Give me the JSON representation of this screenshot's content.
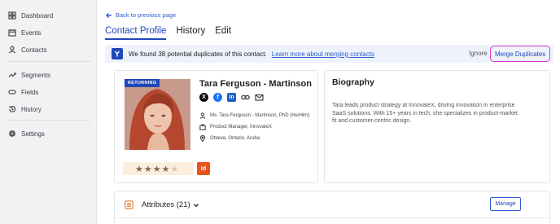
{
  "sidebar": {
    "items": [
      {
        "label": "Dashboard",
        "icon": "dashboard-icon"
      },
      {
        "label": "Events",
        "icon": "calendar-icon"
      },
      {
        "label": "Contacts",
        "icon": "person-icon"
      },
      {
        "label": "Segments",
        "icon": "trend-icon"
      },
      {
        "label": "Fields",
        "icon": "field-icon"
      },
      {
        "label": "History",
        "icon": "history-icon"
      },
      {
        "label": "Settings",
        "icon": "gear-icon"
      }
    ]
  },
  "header": {
    "back_label": "Back to previous page",
    "tabs": [
      "Contact Profile",
      "History",
      "Edit"
    ],
    "active_tab": "Contact Profile"
  },
  "duplicates": {
    "message": "We found 38 potential duplicates of this contact.",
    "learn_more": "Learn more about merging contacts",
    "ignore_label": "Ignore",
    "merge_label": "Merge Duplicates"
  },
  "contact": {
    "badge": "RETURNING",
    "name": "Tara Ferguson - Martinson",
    "social": [
      "x-icon",
      "facebook-icon",
      "linkedin-icon",
      "link-icon",
      "mail-icon"
    ],
    "full_name": "Ms. Tara Ferguson - Martinson, PhD (He/Him)",
    "job": "Product Manager, InnovateX",
    "location": "Ottawa, Ontario, Aruba",
    "rating": 4,
    "rating_max": 5,
    "id_badge": "Id"
  },
  "biography": {
    "title": "Biography",
    "text": "Tara leads product strategy at InnovateX, driving innovation in enterprise SaaS solutions. With 15+ years in tech, she specializes in product-market fit and customer-centric design."
  },
  "attributes": {
    "label": "Attributes (21)",
    "manage_label": "Manage"
  },
  "colors": {
    "accent": "#1f48b8",
    "highlight": "#d63ad6",
    "id_badge": "#e8531b",
    "banner_bg": "#eef3fb"
  }
}
